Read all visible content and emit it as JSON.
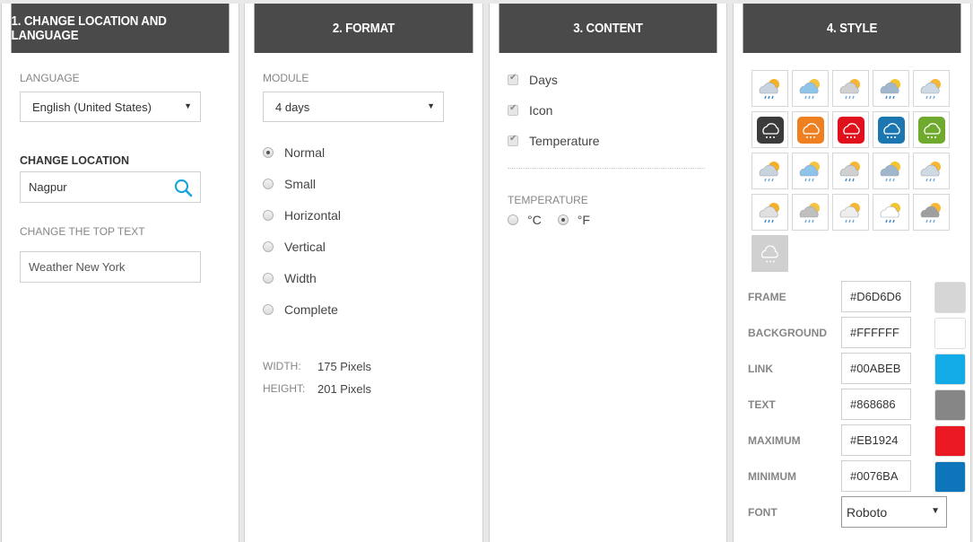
{
  "panels": [
    {
      "title": "1. CHANGE LOCATION AND LANGUAGE"
    },
    {
      "title": "2. FORMAT"
    },
    {
      "title": "3. CONTENT"
    },
    {
      "title": "4. STYLE"
    }
  ],
  "location": {
    "language_label": "LANGUAGE",
    "language_value": "English (United States)",
    "change_location_label": "CHANGE LOCATION",
    "location_value": "Nagpur",
    "top_text_label": "CHANGE THE TOP TEXT",
    "top_text_value": "Weather New York"
  },
  "format": {
    "module_label": "MODULE",
    "module_value": "4 days",
    "layouts": [
      {
        "label": "Normal",
        "checked": true
      },
      {
        "label": "Small",
        "checked": false
      },
      {
        "label": "Horizontal",
        "checked": false
      },
      {
        "label": "Vertical",
        "checked": false
      },
      {
        "label": "Width",
        "checked": false
      },
      {
        "label": "Complete",
        "checked": false
      }
    ],
    "width_label": "WIDTH:",
    "width_value": "175 Pixels",
    "height_label": "HEIGHT:",
    "height_value": "201 Pixels"
  },
  "content": {
    "options": [
      {
        "label": "Days",
        "checked": true
      },
      {
        "label": "Icon",
        "checked": true
      },
      {
        "label": "Temperature",
        "checked": true
      }
    ],
    "temperature_label": "TEMPERATURE",
    "units": [
      {
        "label": "°C",
        "checked": false
      },
      {
        "label": "°F",
        "checked": true
      }
    ]
  },
  "style": {
    "icon_sets": [
      "storm-sun-icon",
      "rain-sun-cloud-icon",
      "snow-sun-cloud-icon",
      "light-snow-sun-icon",
      "rain-drop-sun-icon",
      "black-square-rain-icon",
      "orange-square-rain-icon",
      "red-square-rain-icon",
      "blue-square-rain-icon",
      "green-square-rain-icon",
      "grey-cloud-drops-icon",
      "blue-cloud-drops-icon",
      "dark-cloud-sun-icon",
      "blue-storm-cloud-icon",
      "bright-sun-cloud-icon",
      "pale-sun-snow-icon",
      "grey-sun-rain-icon",
      "white-cloud-sun-rain-icon",
      "outline-sun-rain-icon",
      "flat-grey-cloud-icon",
      "grey-square-rain-icon"
    ],
    "selected_icon_set": 20,
    "colors": [
      {
        "label": "FRAME",
        "value": "#D6D6D6",
        "swatch": "#d6d6d6"
      },
      {
        "label": "BACKGROUND",
        "value": "#FFFFFF",
        "swatch": "#ffffff"
      },
      {
        "label": "LINK",
        "value": "#00ABEB",
        "swatch": "#12abe8"
      },
      {
        "label": "TEXT",
        "value": "#868686",
        "swatch": "#868686"
      },
      {
        "label": "MAXIMUM",
        "value": "#EB1924",
        "swatch": "#eb1924"
      },
      {
        "label": "MINIMUM",
        "value": "#0076BA",
        "swatch": "#0d76ba"
      }
    ],
    "font_label": "FONT",
    "font_value": "Roboto"
  },
  "accent_color": "#00ABEB"
}
